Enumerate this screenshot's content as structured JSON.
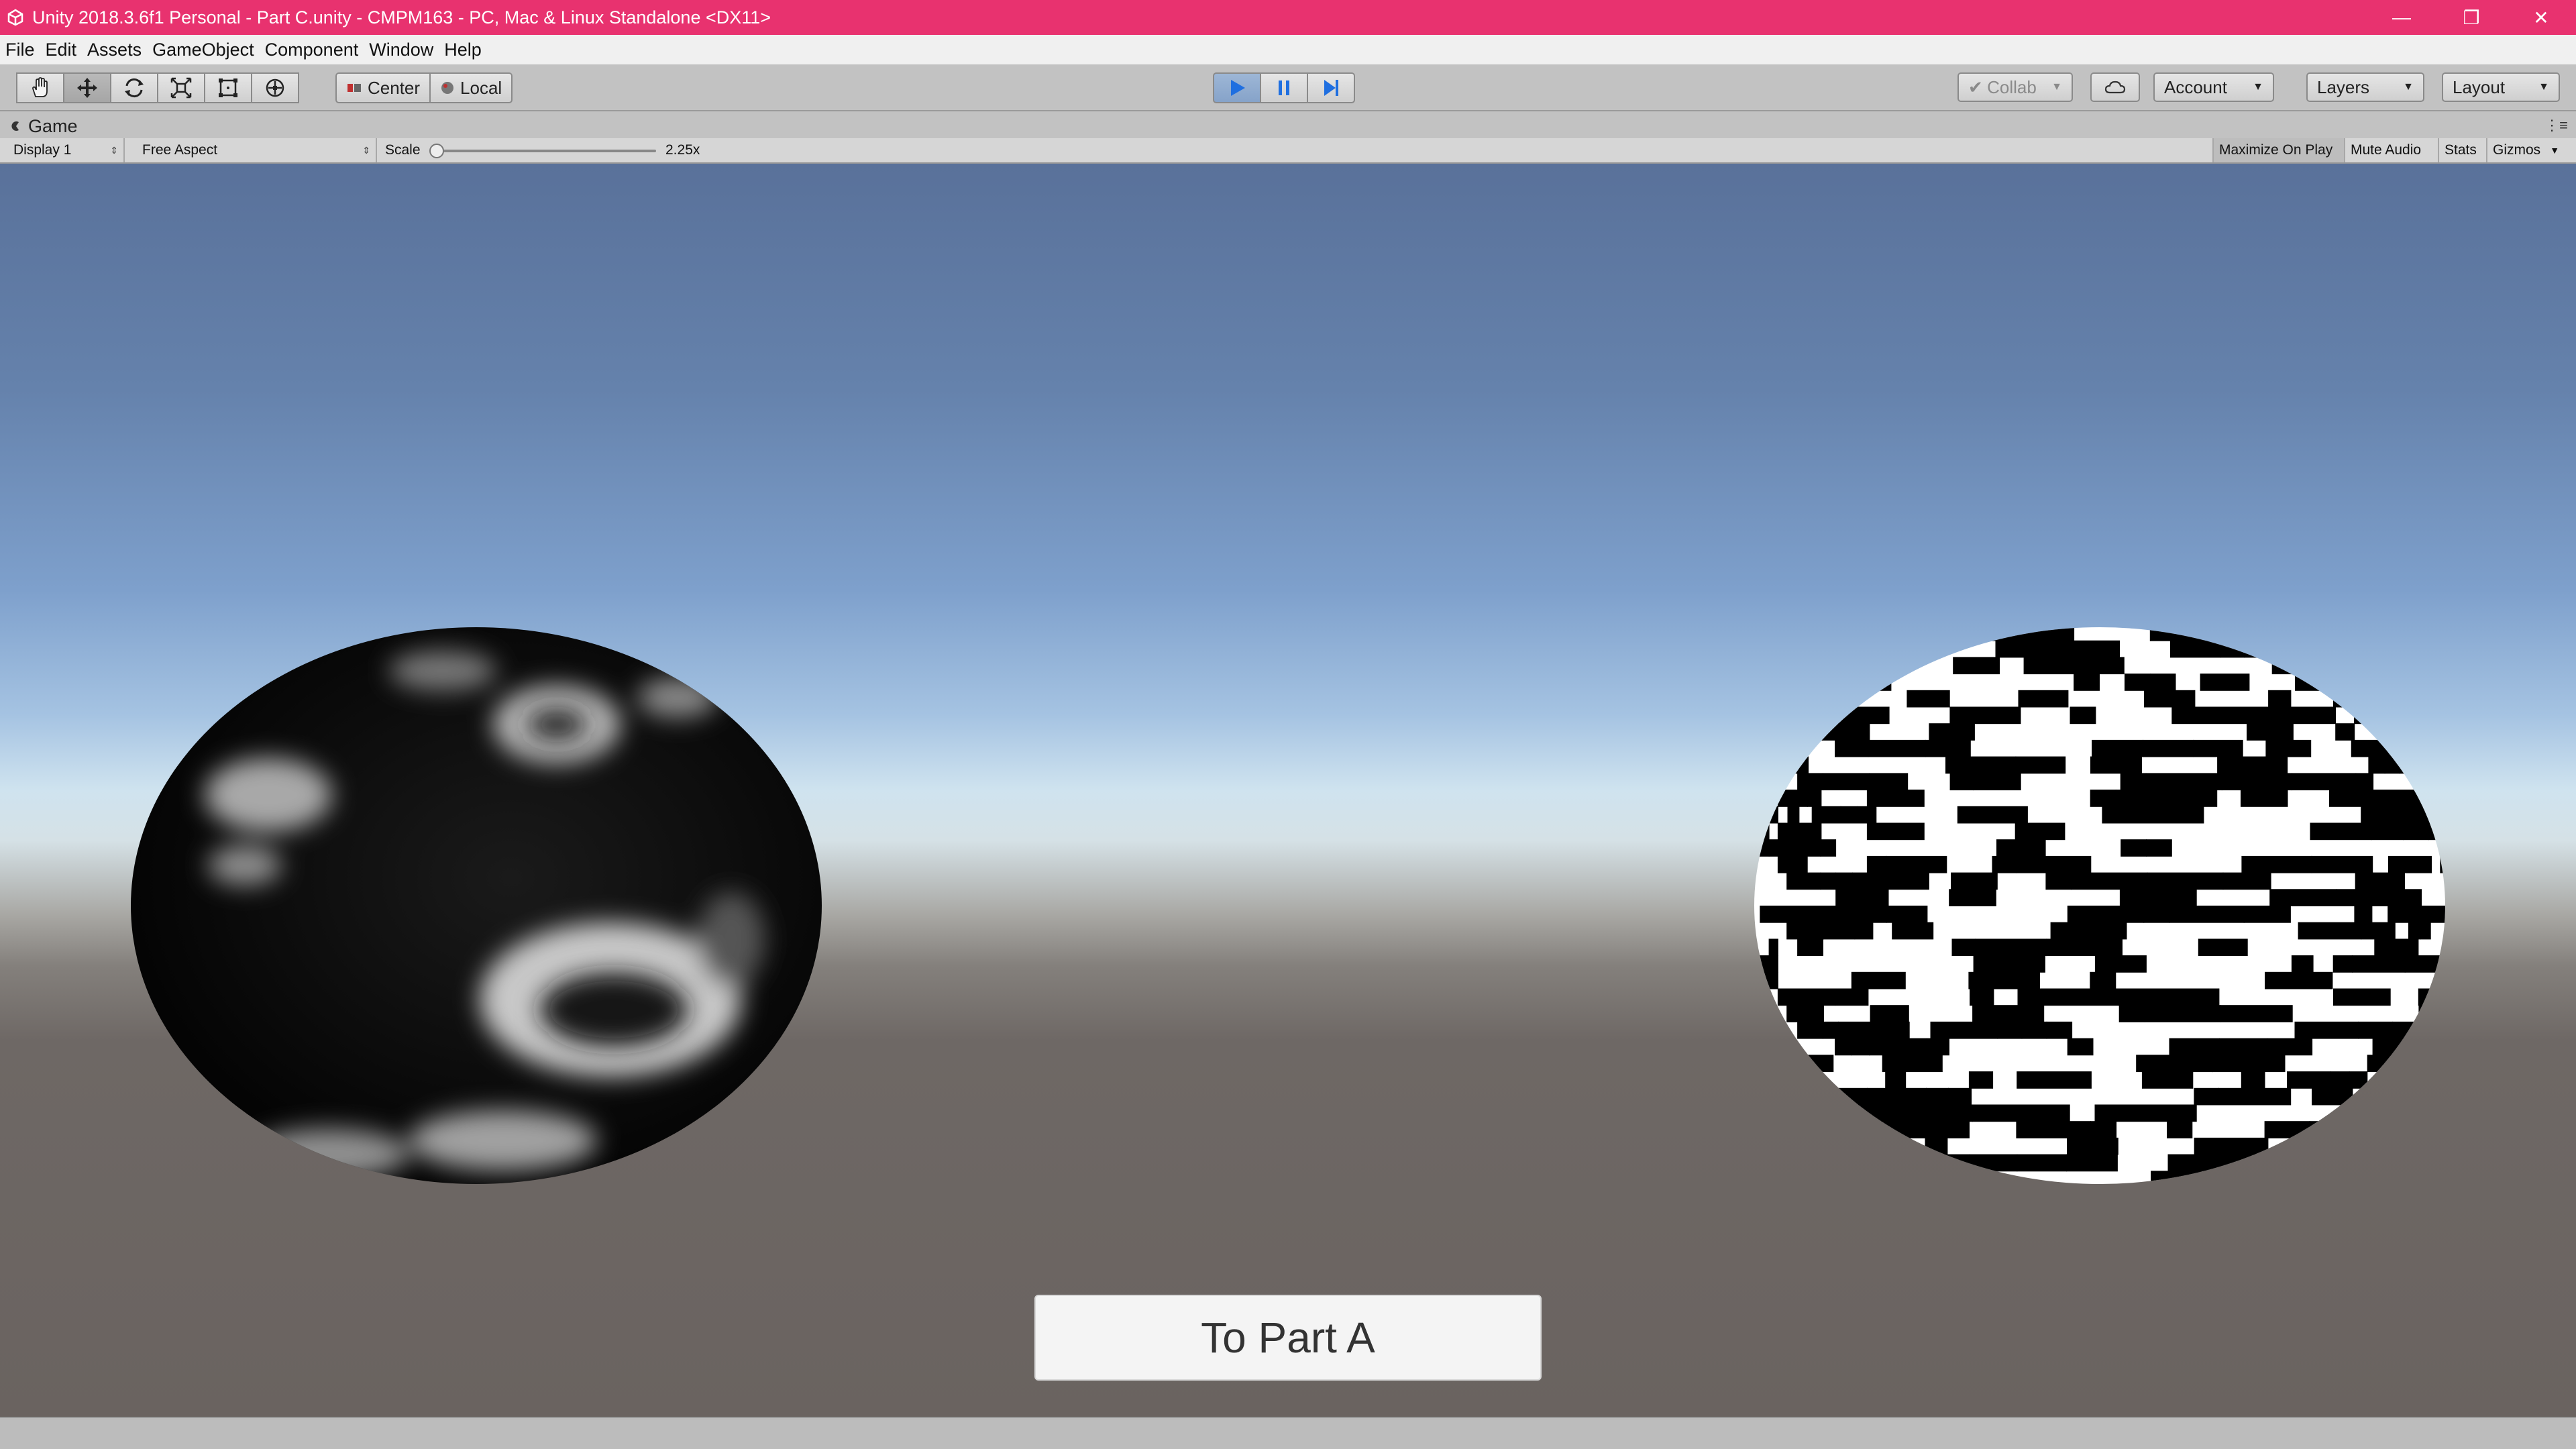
{
  "window": {
    "title": "Unity 2018.3.6f1 Personal - Part C.unity - CMPM163 - PC, Mac & Linux Standalone <DX11>",
    "minimize": "—",
    "restore": "❐",
    "close": "✕"
  },
  "menu": {
    "items": [
      "File",
      "Edit",
      "Assets",
      "GameObject",
      "Component",
      "Window",
      "Help"
    ]
  },
  "toolbar": {
    "tools": [
      "hand-tool-icon",
      "move-tool-icon",
      "rotate-tool-icon",
      "scale-tool-icon",
      "rect-tool-icon",
      "transform-tool-icon"
    ],
    "pivot_label": "Center",
    "space_label": "Local",
    "collab_label": "Collab",
    "account_label": "Account",
    "layers_label": "Layers",
    "layout_label": "Layout",
    "play_state": "playing"
  },
  "game_panel": {
    "tab_label": "Game",
    "display": "Display 1",
    "aspect": "Free Aspect",
    "scale_label": "Scale",
    "scale_value": "2.25x",
    "maximize_label": "Maximize On Play",
    "mute_label": "Mute Audio",
    "stats_label": "Stats",
    "gizmos_label": "Gizmos"
  },
  "scene": {
    "button_label": "To Part A",
    "colors": {
      "sky_top": "#59719a",
      "horizon": "#d5e1e6",
      "ground": "#6a6360"
    }
  }
}
